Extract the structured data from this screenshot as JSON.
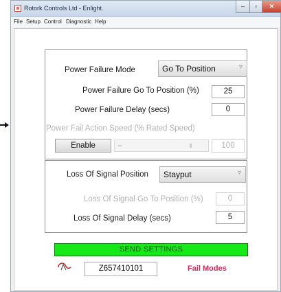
{
  "window": {
    "title": "Rotork Controls Ltd - Enlight.",
    "minimize": "–",
    "maximize": "▫",
    "close": "✕"
  },
  "menu": [
    "File",
    "Setup",
    "Control",
    "Diagnostic",
    "Help"
  ],
  "power_failure": {
    "mode_label": "Power Failure Mode",
    "mode_value": "Go To Position",
    "goto_label": "Power Failure Go To Position (%)",
    "goto_value": "25",
    "delay_label": "Power Failure Delay (secs)",
    "delay_value": "0",
    "speed_label": "Power Fail Action Speed (% Rated Speed)",
    "speed_value": "100",
    "enable_button": "Enable"
  },
  "loss_of_signal": {
    "position_label": "Loss Of Signal Position",
    "position_value": "Stayput",
    "goto_label": "Loss Of Signal Go To Position (%)",
    "goto_value": "0",
    "delay_label": "Loss Of Signal Delay (secs)",
    "delay_value": "5"
  },
  "footer": {
    "send_button": "SEND SETTINGS",
    "serial": "Z657410101",
    "mode_link": "Fail Modes"
  },
  "colors": {
    "send_green": "#17e817",
    "fail_modes_red": "#e0265a"
  },
  "icons": {
    "dropdown": "▿",
    "logo": "rotork-logo"
  }
}
